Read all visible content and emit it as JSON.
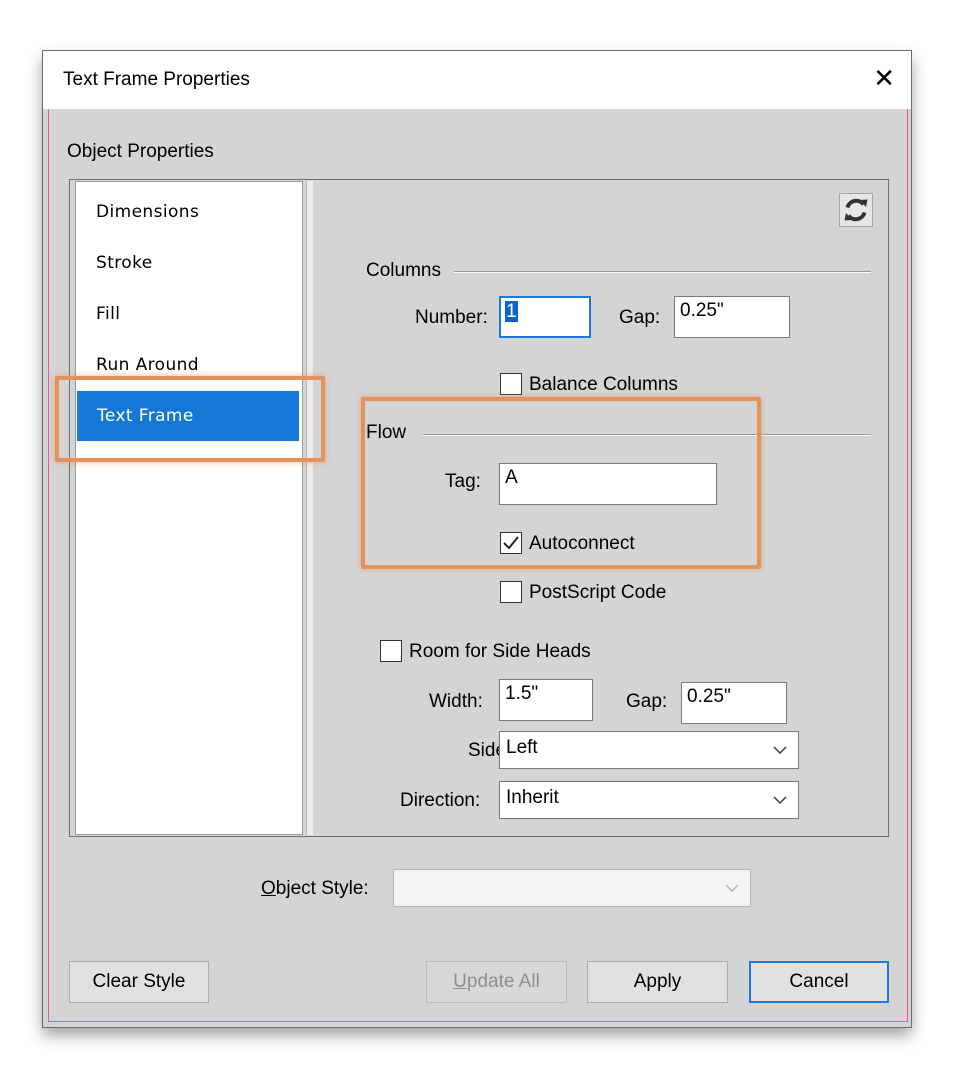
{
  "window": {
    "title": "Text Frame Properties",
    "close_glyph": "✕"
  },
  "section_label": "Object Properties",
  "nav": {
    "items": [
      {
        "label": "Dimensions"
      },
      {
        "label": "Stroke"
      },
      {
        "label": "Fill"
      },
      {
        "label": "Run Around"
      },
      {
        "label": "Text Frame",
        "selected": true
      }
    ]
  },
  "columns": {
    "heading": "Columns",
    "number_label": "Number:",
    "number_value": "1",
    "gap_label": "Gap:",
    "gap_value": "0.25\"",
    "balance_label": "Balance Columns",
    "balance_checked": false
  },
  "flow": {
    "heading": "Flow",
    "tag_label": "Tag:",
    "tag_value": "A",
    "autoconnect_label": "Autoconnect",
    "autoconnect_checked": true,
    "postscript_label": "PostScript Code",
    "postscript_checked": false
  },
  "side_heads": {
    "room_label": "Room for Side Heads",
    "room_checked": false,
    "width_label": "Width:",
    "width_value": "1.5\"",
    "gap_label": "Gap:",
    "gap_value": "0.25\"",
    "side_label": "Side:",
    "side_value": "Left",
    "direction_label": "Direction:",
    "direction_value": "Inherit"
  },
  "object_style": {
    "label_prefix": "O",
    "label_rest": "bject Style:",
    "value": ""
  },
  "buttons": {
    "clear_style": "Clear Style",
    "update_all_prefix": "U",
    "update_all_rest": "pdate All",
    "apply": "Apply",
    "cancel": "Cancel"
  },
  "colors": {
    "selection": "#1479d6",
    "highlight_annotation": "#e4925c",
    "dialog_bg": "#d4d4d4"
  },
  "icons": {
    "refresh": "refresh-icon",
    "chevron": "chevron-down-icon",
    "check": "checkmark-icon"
  }
}
